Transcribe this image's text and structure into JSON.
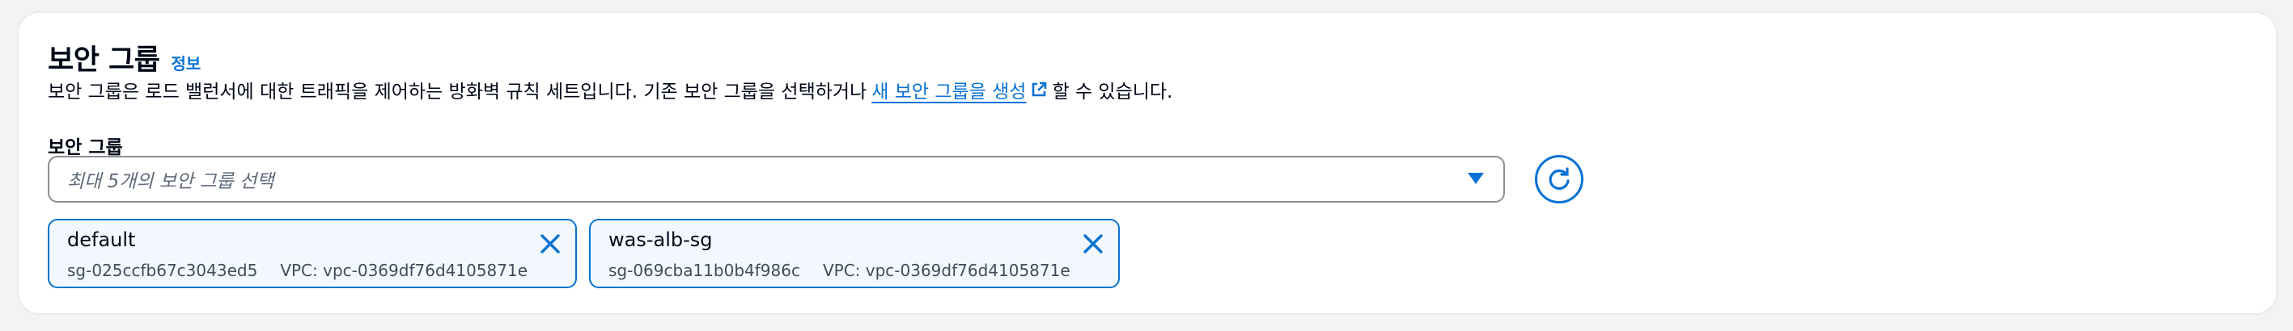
{
  "section": {
    "title": "보안 그룹",
    "info_link": "정보",
    "description_pre": "보안 그룹은 로드 밸런서에 대한 트래픽을 제어하는 방화벽 규칙 세트입니다. 기존 보안 그룹을 선택하거나",
    "description_link": "새 보안 그룹을 생성",
    "description_post": "할 수 있습니다."
  },
  "field": {
    "label": "보안 그룹",
    "placeholder": "최대 5개의 보안 그룹 선택"
  },
  "tokens": [
    {
      "name": "default",
      "id": "sg-025ccfb67c3043ed5",
      "vpc": "VPC: vpc-0369df76d4105871e"
    },
    {
      "name": "was-alb-sg",
      "id": "sg-069cba11b0b4f986c",
      "vpc": "VPC: vpc-0369df76d4105871e"
    }
  ],
  "icons": {
    "external": "external-link-icon",
    "caret": "caret-down-icon",
    "refresh": "refresh-icon",
    "remove": "close-icon"
  },
  "colors": {
    "accent": "#0972d3",
    "token_bg": "#f2f8fd",
    "page_bg": "#f2f3f3"
  }
}
